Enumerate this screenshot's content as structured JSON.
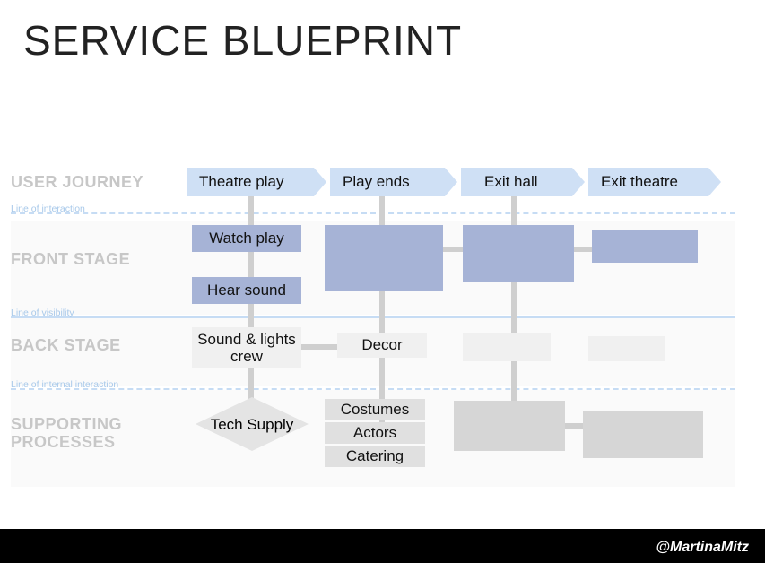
{
  "title": "SERVICE BLUEPRINT",
  "lanes": {
    "journey": "USER JOURNEY",
    "front": "FRONT STAGE",
    "back": "BACK STAGE",
    "support1": "SUPPORTING",
    "support2": "PROCESSES"
  },
  "dividers": {
    "interaction": "Line of interaction",
    "visibility": "Line of visibility",
    "internal": "Line of internal interaction"
  },
  "journey": {
    "s1": "Theatre play",
    "s2": "Play ends",
    "s3": "Exit hall",
    "s4": "Exit theatre"
  },
  "front": {
    "watch": "Watch play",
    "hear": "Hear sound"
  },
  "back": {
    "crew": "Sound & lights crew",
    "decor": "Decor"
  },
  "support": {
    "tech": "Tech Supply",
    "costumes": "Costumes",
    "actors": "Actors",
    "catering": "Catering"
  },
  "handle": "@MartinaMitz"
}
